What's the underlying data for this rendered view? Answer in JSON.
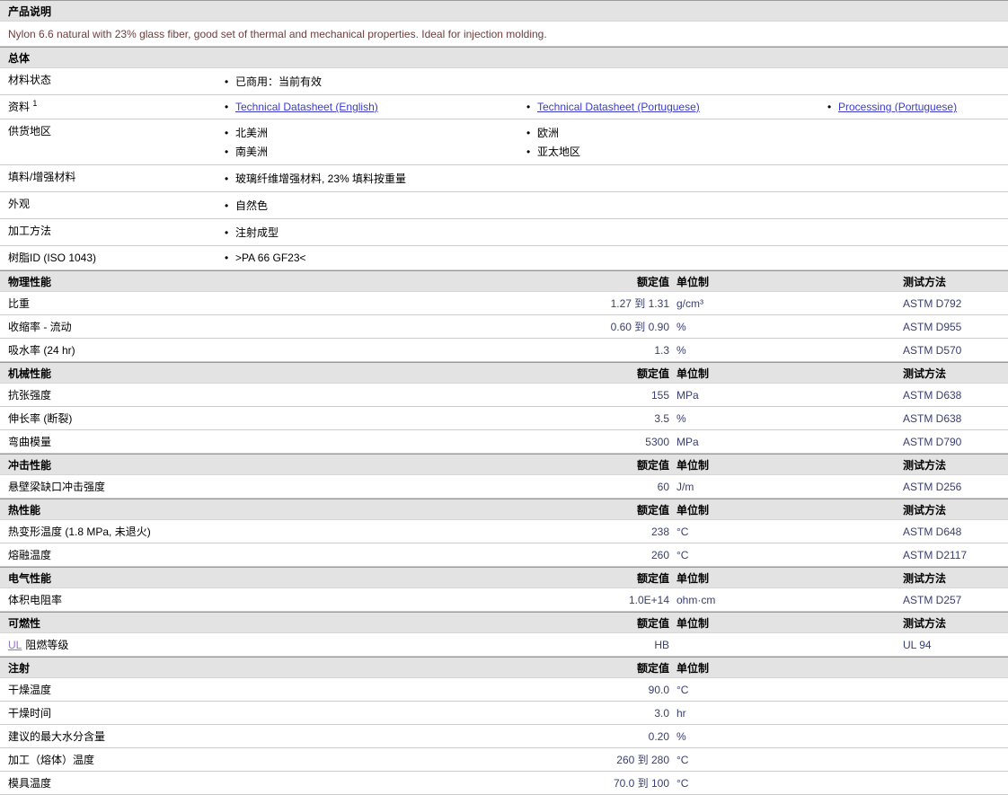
{
  "colors": {
    "section_bar_bg": "#e3e3e3",
    "value_text": "#39406e",
    "description_text": "#6e3d3d",
    "link_blue": "#3a3acd",
    "link_purple": "#9173c9"
  },
  "product": {
    "header": "产品说明",
    "description": "Nylon 6.6 natural with 23% glass fiber, good set of thermal and mechanical properties. Ideal for injection molding."
  },
  "general": {
    "title": "总体",
    "rows": [
      {
        "label": "材料状态",
        "columns": [
          {
            "items": [
              {
                "text": "已商用：当前有效"
              }
            ]
          }
        ]
      },
      {
        "label": "资料",
        "footnote": "1",
        "columns": [
          {
            "items": [
              {
                "text": "Technical Datasheet (English)",
                "link": true
              }
            ]
          },
          {
            "items": [
              {
                "text": "Technical Datasheet (Portuguese)",
                "link": true
              }
            ]
          },
          {
            "items": [
              {
                "text": "Processing (Portuguese)",
                "link": true
              }
            ]
          }
        ]
      },
      {
        "label": "供货地区",
        "columns": [
          {
            "items": [
              {
                "text": "北美洲"
              },
              {
                "text": "南美洲"
              }
            ]
          },
          {
            "items": [
              {
                "text": "欧洲"
              },
              {
                "text": "亚太地区"
              }
            ]
          }
        ]
      },
      {
        "label": "填料/增强材料",
        "columns": [
          {
            "items": [
              {
                "text": "玻璃纤维增强材料, 23% 填料按重量"
              }
            ]
          }
        ]
      },
      {
        "label": "外观",
        "columns": [
          {
            "items": [
              {
                "text": "自然色"
              }
            ]
          }
        ]
      },
      {
        "label": "加工方法",
        "columns": [
          {
            "items": [
              {
                "text": "注射成型"
              }
            ]
          }
        ]
      },
      {
        "label": "树脂ID (ISO 1043)",
        "columns": [
          {
            "items": [
              {
                "text": ">PA 66 GF23<"
              }
            ]
          }
        ]
      }
    ]
  },
  "property_table": {
    "col_headers": {
      "rated": "额定值",
      "unit": "单位制",
      "test": "测试方法"
    },
    "sections": [
      {
        "title": "物理性能",
        "show_test_header": true,
        "rows": [
          {
            "label": "比重",
            "value": "1.27 到  1.31",
            "unit": "g/cm³",
            "test": "ASTM D792"
          },
          {
            "label": "收缩率 - 流动",
            "value": "0.60 到  0.90",
            "unit": "%",
            "test": "ASTM D955"
          },
          {
            "label": "吸水率 (24 hr)",
            "value": "1.3",
            "unit": "%",
            "test": "ASTM D570"
          }
        ]
      },
      {
        "title": "机械性能",
        "show_test_header": true,
        "rows": [
          {
            "label": "抗张强度",
            "value": "155",
            "unit": "MPa",
            "test": "ASTM D638"
          },
          {
            "label": "伸长率 (断裂)",
            "value": "3.5",
            "unit": "%",
            "test": "ASTM D638"
          },
          {
            "label": "弯曲模量",
            "value": "5300",
            "unit": "MPa",
            "test": "ASTM D790"
          }
        ]
      },
      {
        "title": "冲击性能",
        "show_test_header": true,
        "rows": [
          {
            "label": "悬壁梁缺口冲击强度",
            "value": "60",
            "unit": "J/m",
            "test": "ASTM D256"
          }
        ]
      },
      {
        "title": "热性能",
        "show_test_header": true,
        "rows": [
          {
            "label": "热变形温度  (1.8 MPa, 未退火)",
            "value": "238",
            "unit": "°C",
            "test": "ASTM D648"
          },
          {
            "label": "熔融温度",
            "value": "260",
            "unit": "°C",
            "test": "ASTM D2117"
          }
        ]
      },
      {
        "title": "电气性能",
        "show_test_header": true,
        "rows": [
          {
            "label": "体积电阻率",
            "value": "1.0E+14",
            "unit": "ohm·cm",
            "test": "ASTM D257"
          }
        ]
      },
      {
        "title": "可燃性",
        "show_test_header": true,
        "rows": [
          {
            "label": "阻燃等级",
            "label_link": "UL",
            "value": "HB",
            "unit": "",
            "test": "UL 94"
          }
        ]
      },
      {
        "title": "注射",
        "show_test_header": false,
        "rows": [
          {
            "label": "干燥温度",
            "value": "90.0",
            "unit": "°C",
            "test": ""
          },
          {
            "label": "干燥时间",
            "value": "3.0",
            "unit": "hr",
            "test": ""
          },
          {
            "label": "建议的最大水分含量",
            "value": "0.20",
            "unit": "%",
            "test": ""
          },
          {
            "label": "加工（熔体）温度",
            "value": "260 到  280",
            "unit": "°C",
            "test": ""
          },
          {
            "label": "模具温度",
            "value": "70.0 到  100",
            "unit": "°C",
            "test": ""
          }
        ]
      }
    ]
  }
}
